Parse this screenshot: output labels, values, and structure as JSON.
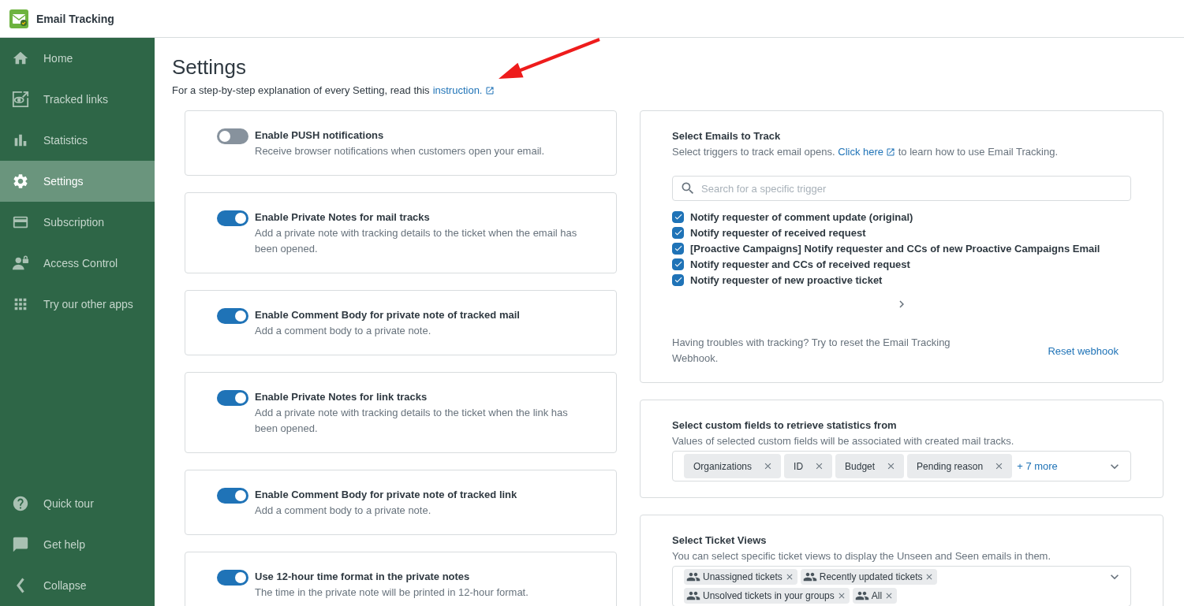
{
  "app": {
    "title": "Email Tracking"
  },
  "sidebar": {
    "items": [
      {
        "label": "Home",
        "selected": false
      },
      {
        "label": "Tracked links",
        "selected": false
      },
      {
        "label": "Statistics",
        "selected": false
      },
      {
        "label": "Settings",
        "selected": true
      },
      {
        "label": "Subscription",
        "selected": false
      },
      {
        "label": "Access Control",
        "selected": false
      },
      {
        "label": "Try our other apps",
        "selected": false
      }
    ],
    "bottom_items": [
      {
        "label": "Quick tour"
      },
      {
        "label": "Get help"
      },
      {
        "label": "Collapse"
      }
    ]
  },
  "page": {
    "title": "Settings",
    "intro": "For a step-by-step explanation of every Setting, read this",
    "intro_link": "instruction."
  },
  "annotation": {
    "kind": "arrow"
  },
  "toggles": [
    {
      "title": "Enable PUSH notifications",
      "description": "Receive browser notifications when customers open your email.",
      "on": false
    },
    {
      "title": "Enable Private Notes for mail tracks",
      "description": "Add a private note with tracking details to the ticket when the email has been opened.",
      "on": true
    },
    {
      "title": "Enable Comment Body for private note of tracked mail",
      "description": "Add a comment body to a private note.",
      "on": true
    },
    {
      "title": "Enable Private Notes for link tracks",
      "description": "Add a private note with tracking details to the ticket when the link has been opened.",
      "on": true
    },
    {
      "title": "Enable Comment Body for private note of tracked link",
      "description": "Add a comment body to a private note.",
      "on": true
    },
    {
      "title": "Use 12-hour time format in the private notes",
      "description": "The time in the private note will be printed in 12-hour format.",
      "on": true
    }
  ],
  "emails": {
    "title": "Select Emails to Track",
    "description_before": "Select triggers to track email opens.",
    "link": "Click here",
    "description_after": "to learn how to use Email Tracking.",
    "search_placeholder": "Search for a specific trigger",
    "triggers": [
      {
        "label": "Notify requester of comment update (original)",
        "checked": true
      },
      {
        "label": "Notify requester of received request",
        "checked": true
      },
      {
        "label": "[Proactive Campaigns] Notify requester and CCs of new Proactive Campaigns Email",
        "checked": true
      },
      {
        "label": "Notify requester and CCs of received request",
        "checked": true
      },
      {
        "label": "Notify requester of new proactive ticket",
        "checked": true
      }
    ],
    "webhook_note": "Having troubles with tracking? Try to reset the Email Tracking Webhook.",
    "webhook_button": "Reset webhook"
  },
  "custom_fields": {
    "title": "Select custom fields to retrieve statistics from",
    "description": "Values of selected custom fields will be associated with created mail tracks.",
    "tags": [
      "Organizations",
      "ID",
      "Budget",
      "Pending reason"
    ],
    "more": "+ 7 more"
  },
  "ticket_views": {
    "title": "Select Ticket Views",
    "description": "You can select specific ticket views to display the Unseen and Seen emails in them.",
    "tags": [
      "Unassigned tickets",
      "Recently updated tickets",
      "Unsolved tickets in your groups",
      "All"
    ]
  }
}
